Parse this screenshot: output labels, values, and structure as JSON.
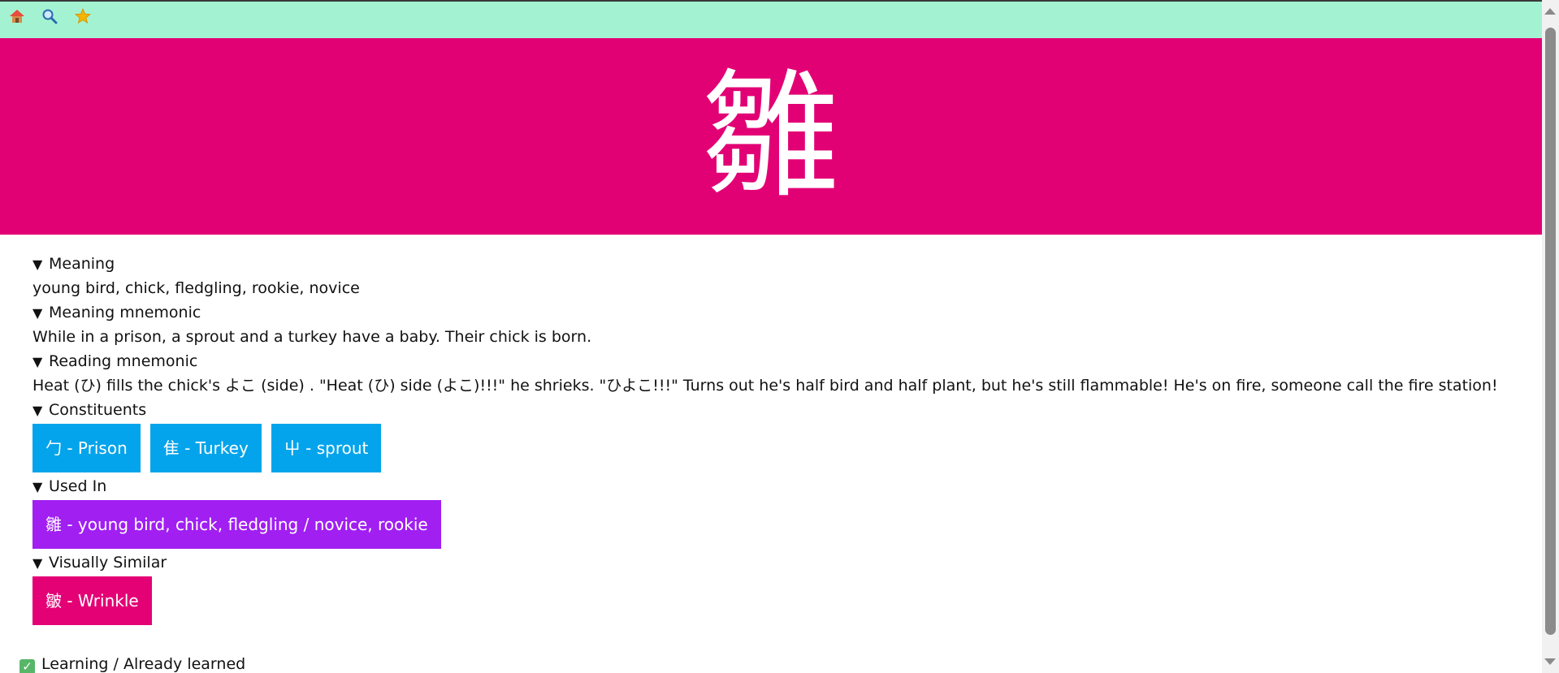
{
  "nav": {
    "icons": [
      "home-icon",
      "search-icon",
      "star-icon"
    ],
    "home_glyph": "🏠",
    "search_glyph": "🔍",
    "star_glyph": "⭐"
  },
  "hero": {
    "kanji": "雛",
    "background": "#e20075"
  },
  "sections": {
    "arrow": "▼",
    "meaning": {
      "title": "Meaning",
      "text": "young bird, chick, fledgling, rookie, novice"
    },
    "meaning_mnemonic": {
      "title": "Meaning mnemonic",
      "text": "While in a prison, a sprout and a turkey have a baby. Their chick is born."
    },
    "reading_mnemonic": {
      "title": "Reading mnemonic",
      "text": "Heat (ひ) fills the chick's よこ (side) . \"Heat (ひ) side (よこ)!!!\" he shrieks. \"ひよこ!!!\" Turns out he's half bird and half plant, but he's still flammable! He's on fire, someone call the fire station!"
    },
    "constituents": {
      "title": "Constituents",
      "items": [
        "勹 - Prison",
        "隹 - Turkey",
        "屮 - sprout"
      ],
      "color": "#03a4eb"
    },
    "used_in": {
      "title": "Used In",
      "items": [
        "雛 - young bird, chick, fledgling / novice, rookie"
      ],
      "color": "#a11ff1"
    },
    "visually_similar": {
      "title": "Visually Similar",
      "items": [
        "皺 - Wrinkle"
      ],
      "color": "#e40075"
    }
  },
  "status": {
    "check_glyph": "✓",
    "label": "Learning / Already learned"
  },
  "colors": {
    "topbar": "#a3f3d2",
    "accent_pink": "#e20075"
  }
}
